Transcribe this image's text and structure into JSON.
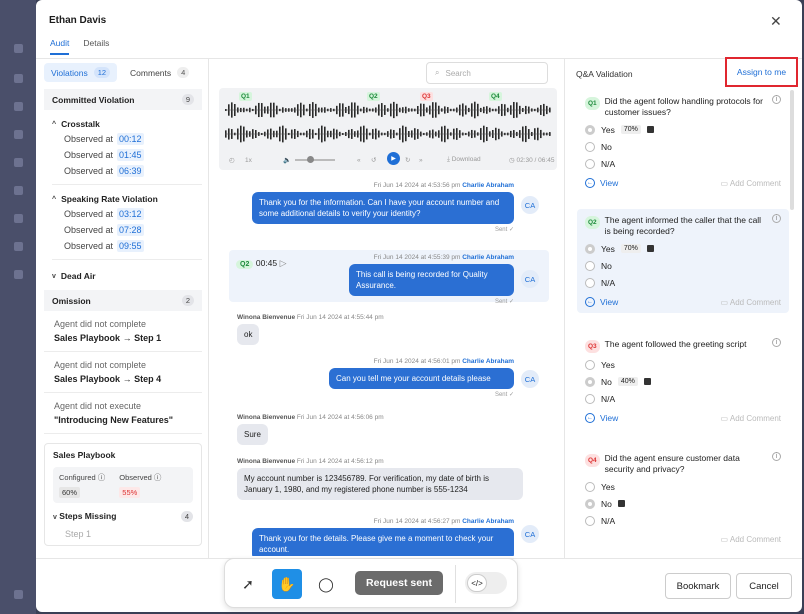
{
  "header": {
    "title": "Ethan Davis",
    "close_icon": "close-icon"
  },
  "tabs": [
    {
      "label": "Audit"
    },
    {
      "label": "Details"
    }
  ],
  "left": {
    "tabs": [
      {
        "label": "Violations",
        "count": "12"
      },
      {
        "label": "Comments",
        "count": "4"
      }
    ],
    "committed": {
      "title": "Committed Violation",
      "count": "9",
      "groups": [
        {
          "title": "Crosstalk",
          "items": [
            {
              "label": "Observed at",
              "time": "00:12"
            },
            {
              "label": "Observed at",
              "time": "01:45"
            },
            {
              "label": "Observed at",
              "time": "06:39"
            }
          ]
        },
        {
          "title": "Speaking Rate Violation",
          "items": [
            {
              "label": "Observed at",
              "time": "03:12"
            },
            {
              "label": "Observed at",
              "time": "07:28"
            },
            {
              "label": "Observed at",
              "time": "09:55"
            }
          ]
        },
        {
          "title": "Dead Air"
        }
      ]
    },
    "omission": {
      "title": "Omission",
      "count": "2",
      "items": [
        {
          "l1": "Agent did not complete",
          "l2a": "Sales Playbook",
          "l2b": "Step 1"
        },
        {
          "l1": "Agent did not complete",
          "l2a": "Sales Playbook",
          "l2b": "Step 4"
        },
        {
          "l1": "Agent did not execute",
          "l2": "\"Introducing New Features\""
        }
      ]
    },
    "playbook": {
      "title": "Sales Playbook",
      "configured_label": "Configured",
      "configured_value": "60%",
      "observed_label": "Observed",
      "observed_value": "55%",
      "steps_label": "Steps Missing",
      "steps_count": "4",
      "steps_sub": "Step 1"
    }
  },
  "center": {
    "search_placeholder": "Search",
    "markers": [
      "Q1",
      "Q2",
      "Q3",
      "Q4"
    ],
    "download_label": "Download",
    "time_label": "02:30 / 06:45",
    "speed_label": "1x",
    "messages": [
      {
        "meta": "Fri Jun 14 2024 at 4:53:56 pm",
        "speaker": "Charlie Abraham",
        "text": "Thank you for the information. Can I have your account number and some additional details to verify your identity?",
        "avatar": "CA",
        "sent": "Sent"
      },
      {
        "tag": "Q2",
        "time": "00:45",
        "meta": "Fri Jun 14 2024 at 4:55:39 pm",
        "speaker": "Charlie Abraham",
        "text": "This call is being recorded for Quality Assurance.",
        "avatar": "CA",
        "sent": "Sent"
      },
      {
        "speaker": "Winona Bienvenue",
        "meta": "Fri Jun 14 2024 at 4:55:44 pm",
        "text": "ok"
      },
      {
        "meta": "Fri Jun 14 2024 at 4:56:01 pm",
        "speaker": "Charlie Abraham",
        "text": "Can you tell me your account details please",
        "avatar": "CA",
        "sent": "Sent"
      },
      {
        "speaker": "Winona Bienvenue",
        "meta": "Fri Jun 14 2024 at 4:56:06 pm",
        "text": "Sure"
      },
      {
        "speaker": "Winona Bienvenue",
        "meta": "Fri Jun 14 2024 at 4:56:12 pm",
        "text": "My account number is 123456789. For verification, my date of birth is January 1, 1980, and my registered phone number is 555-1234"
      },
      {
        "meta": "Fri Jun 14 2024 at 4:56:27 pm",
        "speaker": "Charlie Abraham",
        "text": "Thank you for the details. Please give me a moment to check your account.",
        "avatar": "CA"
      }
    ]
  },
  "right": {
    "title": "Q&A Validation",
    "assign_label": "Assign to me",
    "view_label": "View",
    "add_comment_label": "Add Comment",
    "questions": [
      {
        "tag": "Q1",
        "text": "Did the agent follow handling protocols for customer issues?",
        "options": [
          "Yes",
          "No",
          "N/A"
        ],
        "selected_index": 0,
        "pct": "70%",
        "show_footer": true
      },
      {
        "tag": "Q2",
        "text": "The agent informed the caller that the call is being recorded?",
        "options": [
          "Yes",
          "No",
          "N/A"
        ],
        "selected_index": 0,
        "pct": "70%",
        "show_footer": true
      },
      {
        "tag": "Q3",
        "text": "The agent followed the greeting script",
        "options": [
          "Yes",
          "No",
          "N/A"
        ],
        "selected_index": 1,
        "pct": "40%",
        "show_footer": true
      },
      {
        "tag": "Q4",
        "text": "Did the agent ensure customer data security and privacy?",
        "options": [
          "Yes",
          "No",
          "N/A"
        ],
        "selected_index": 1,
        "pct": "",
        "show_footer": false
      }
    ]
  },
  "toolbar": {
    "request_label": "Request sent"
  },
  "footer": {
    "bookmark_label": "Bookmark",
    "cancel_label": "Cancel"
  },
  "colors": {
    "accent": "#1f6fd6",
    "highlight": "#e0262f",
    "q_green": "#1c8a3a",
    "q_red": "#d33333"
  }
}
